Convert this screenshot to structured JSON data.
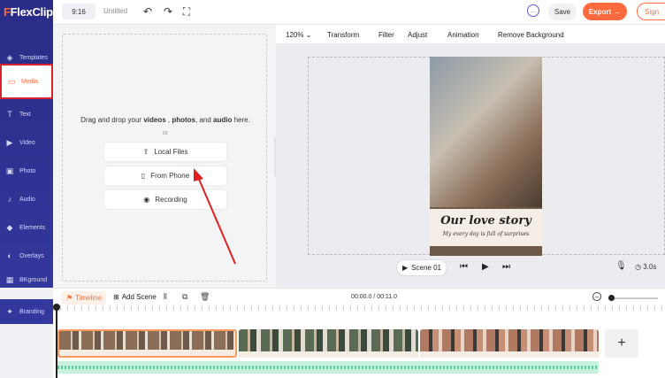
{
  "app": {
    "logo": "FlexClip",
    "project_title": "Untitled",
    "aspect_ratio": "9:16"
  },
  "header": {
    "save_label": "Save",
    "export_label": "Export",
    "sign_label": "Sign"
  },
  "sidebar": {
    "items": [
      {
        "label": "Templates",
        "icon": "templates-icon"
      },
      {
        "label": "Media",
        "icon": "folder-icon"
      },
      {
        "label": "Text",
        "icon": "text-icon"
      },
      {
        "label": "Video",
        "icon": "video-icon"
      },
      {
        "label": "Photo",
        "icon": "photo-icon"
      },
      {
        "label": "Audio",
        "icon": "music-icon"
      },
      {
        "label": "Elements",
        "icon": "elements-icon"
      },
      {
        "label": "Overlays",
        "icon": "overlays-icon"
      },
      {
        "label": "BKground",
        "icon": "background-icon"
      },
      {
        "label": "Branding",
        "icon": "branding-icon"
      }
    ],
    "active": "Media"
  },
  "media": {
    "drop_prefix": "Drag and drop your",
    "videos": "videos",
    "photos": "photos",
    "and": ", and",
    "audio": "audio",
    "here": "here.",
    "or": "or",
    "local_files": "Local Files",
    "from_phone": "From Phone",
    "recording": "Recording"
  },
  "toolbar": {
    "zoom": "120%",
    "transform": "Transform",
    "filter": "Filter",
    "adjust": "Adjust",
    "animation": "Animation",
    "remove_background": "Remove Background"
  },
  "canvas": {
    "caption_title": "Our love story",
    "caption_subtitle": "My every day is full of surprises"
  },
  "player": {
    "scene_label": "Scene  01",
    "duration": "3.0s"
  },
  "timeline": {
    "tab_label": "Timeline",
    "add_scene": "Add Scene",
    "time_readout": "00:00.0 / 00:11.0"
  },
  "colors": {
    "accent": "#ff6b3d",
    "sidebar": "#2d2f8f",
    "highlight": "#d9232e"
  }
}
